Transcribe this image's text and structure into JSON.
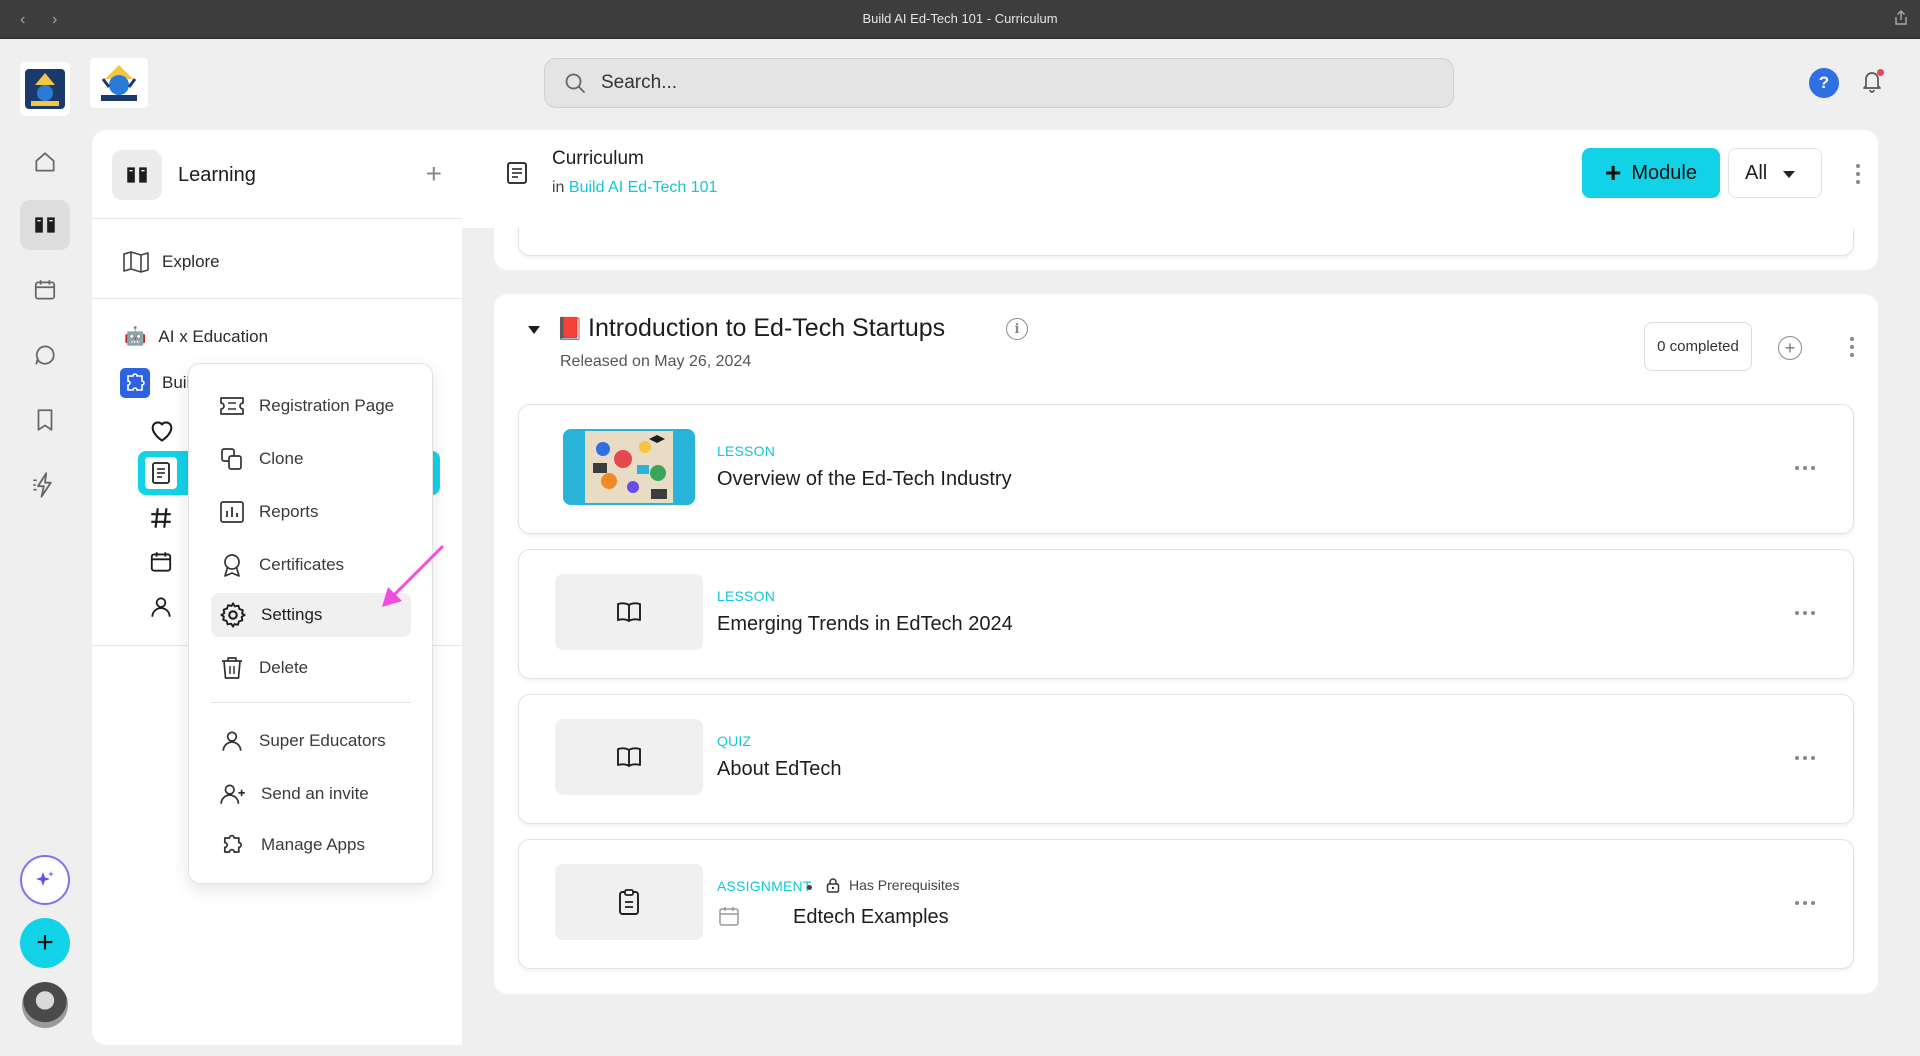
{
  "window": {
    "title": "Build AI Ed-Tech 101 - Curriculum"
  },
  "search": {
    "placeholder": "Search..."
  },
  "header_actions": {
    "help_label": "?"
  },
  "sidebar": {
    "title": "Learning",
    "add_label": "+",
    "explore_label": "Explore",
    "spaces": [
      {
        "label": "AI x Education",
        "icon": "robot-emoji"
      },
      {
        "label": "Buil",
        "icon": "puzzle-icon"
      }
    ]
  },
  "context_menu": {
    "items": [
      {
        "label": "Registration Page",
        "icon": "ticket-icon"
      },
      {
        "label": "Clone",
        "icon": "copy-icon"
      },
      {
        "label": "Reports",
        "icon": "chart-icon"
      },
      {
        "label": "Certificates",
        "icon": "award-icon"
      },
      {
        "label": "Settings",
        "icon": "gear-icon",
        "hovered": true
      },
      {
        "label": "Delete",
        "icon": "trash-icon"
      }
    ],
    "member_items": [
      {
        "label": "Super Educators",
        "icon": "user-icon"
      },
      {
        "label": "Send an invite",
        "icon": "user-plus-icon"
      },
      {
        "label": "Manage Apps",
        "icon": "puzzle-icon"
      }
    ]
  },
  "page_header": {
    "title": "Curriculum",
    "in_prefix": "in",
    "parent_link": "Build AI Ed-Tech 101",
    "module_button": "Module",
    "filter_value": "All"
  },
  "module": {
    "emoji": "📕",
    "title": "Introduction to Ed-Tech Startups",
    "released": "Released on May 26, 2024",
    "completed_label": "0 completed",
    "items": [
      {
        "kind": "LESSON",
        "name": "Overview of the Ed-Tech Industry",
        "thumb": "image"
      },
      {
        "kind": "LESSON",
        "name": "Emerging Trends in EdTech 2024",
        "thumb": "book-icon"
      },
      {
        "kind": "QUIZ",
        "name": "About EdTech",
        "thumb": "book-icon"
      },
      {
        "kind": "ASSIGNMENT",
        "name": "Edtech Examples",
        "thumb": "clipboard-icon",
        "prereq": "Has Prerequisites"
      }
    ]
  },
  "colors": {
    "accent": "#12d2e8",
    "link": "#12c6dc",
    "arrow": "#f24be0",
    "ai_ring": "#8b6df0"
  }
}
